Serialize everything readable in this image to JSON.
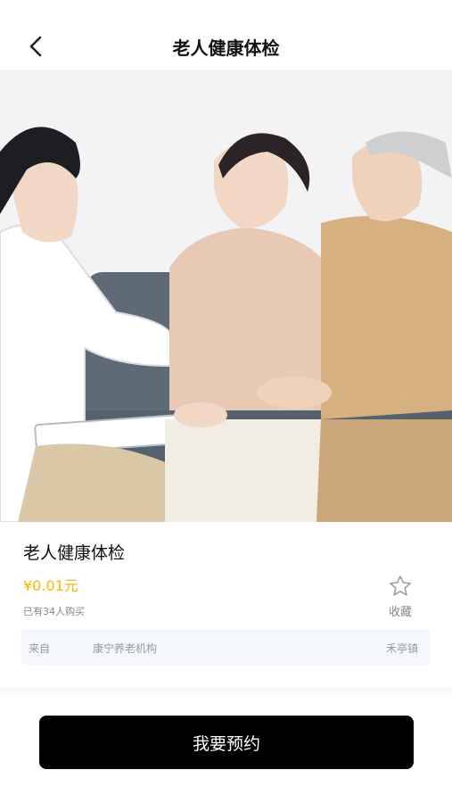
{
  "nav": {
    "title": "老人健康体检",
    "back_icon": "chevron-left-icon"
  },
  "product": {
    "name": "老人健康体检",
    "price": "¥0.01元",
    "sold": "已有34人购买",
    "favorite_label": "收藏",
    "favorite_icon": "star-outline-icon"
  },
  "source": {
    "label": "来自",
    "org": "康宁养老机构",
    "town": "禾亭镇"
  },
  "cta": {
    "label": "我要预约"
  },
  "colors": {
    "price": "#f7b500",
    "cta_bg": "#000000",
    "source_bg": "#f4f8fc"
  }
}
